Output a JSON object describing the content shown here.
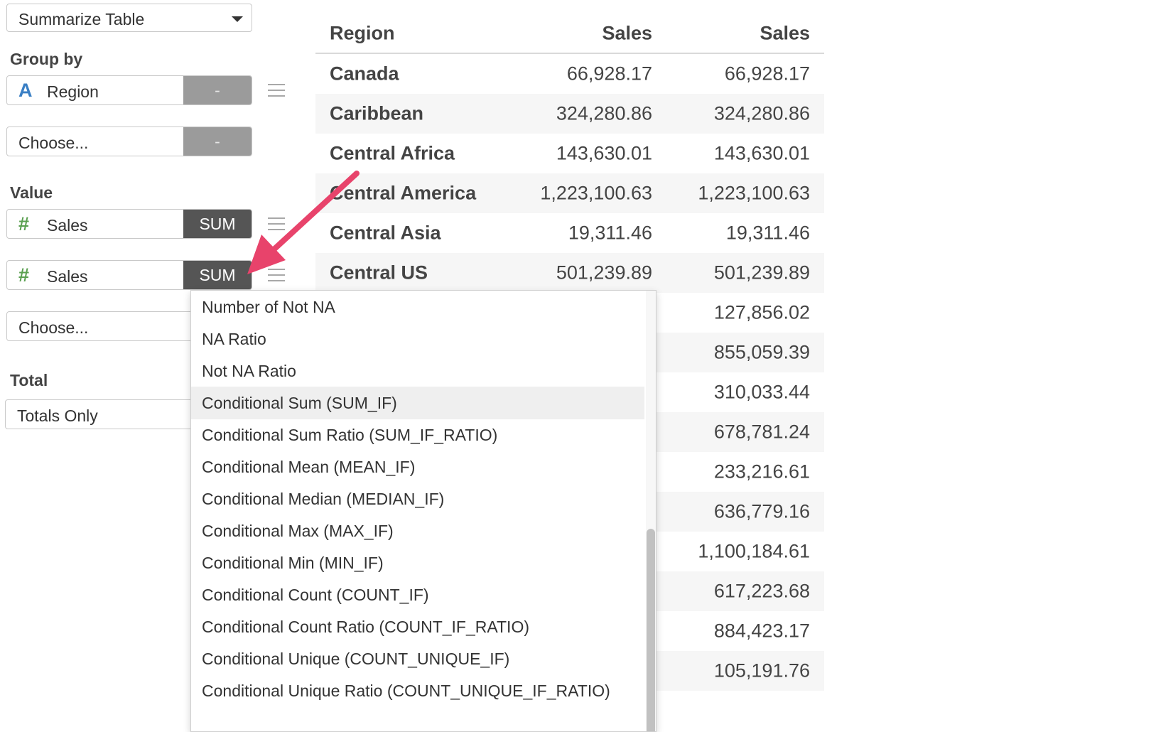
{
  "top_select": {
    "value": "Summarize Table"
  },
  "group_by": {
    "label": "Group by",
    "fields": [
      {
        "icon": "string-type-icon",
        "icon_glyph": "A",
        "icon_color": "#3a7fc4",
        "name": "Region",
        "button": "-"
      },
      {
        "name": "Choose...",
        "button": "-"
      }
    ]
  },
  "value": {
    "label": "Value",
    "fields": [
      {
        "icon": "numeric-type-icon",
        "icon_glyph": "#",
        "icon_color": "#5aa050",
        "name": "Sales",
        "button": "SUM"
      },
      {
        "icon": "numeric-type-icon",
        "icon_glyph": "#",
        "icon_color": "#5aa050",
        "name": "Sales",
        "button": "SUM"
      },
      {
        "name": "Choose..."
      }
    ]
  },
  "total": {
    "label": "Total",
    "value": "Totals Only"
  },
  "table": {
    "headers": [
      "Region",
      "Sales",
      "Sales"
    ],
    "rows": [
      [
        "Canada",
        "66,928.17",
        "66,928.17"
      ],
      [
        "Caribbean",
        "324,280.86",
        "324,280.86"
      ],
      [
        "Central Africa",
        "143,630.01",
        "143,630.01"
      ],
      [
        "Central America",
        "1,223,100.63",
        "1,223,100.63"
      ],
      [
        "Central Asia",
        "19,311.46",
        "19,311.46"
      ],
      [
        "Central US",
        "501,239.89",
        "501,239.89"
      ],
      [
        "",
        "",
        "127,856.02"
      ],
      [
        "",
        "",
        "855,059.39"
      ],
      [
        "",
        "",
        "310,033.44"
      ],
      [
        "",
        "",
        "678,781.24"
      ],
      [
        "",
        "",
        "233,216.61"
      ],
      [
        "",
        "",
        "636,779.16"
      ],
      [
        "",
        "",
        "1,100,184.61"
      ],
      [
        "",
        "",
        "617,223.68"
      ],
      [
        "",
        "",
        "884,423.17"
      ],
      [
        "",
        "",
        "105,191.76"
      ]
    ]
  },
  "dropdown": {
    "highlighted_index": 3,
    "items": [
      "Number of Not NA",
      "NA Ratio",
      "Not NA Ratio",
      "Conditional Sum (SUM_IF)",
      "Conditional Sum Ratio (SUM_IF_RATIO)",
      "Conditional Mean (MEAN_IF)",
      "Conditional Median (MEDIAN_IF)",
      "Conditional Max (MAX_IF)",
      "Conditional Min (MIN_IF)",
      "Conditional Count (COUNT_IF)",
      "Conditional Count Ratio (COUNT_IF_RATIO)",
      "Conditional Unique (COUNT_UNIQUE_IF)",
      "Conditional Unique Ratio (COUNT_UNIQUE_IF_RATIO)"
    ]
  },
  "annotation": {
    "arrow_color": "#e8436b"
  }
}
